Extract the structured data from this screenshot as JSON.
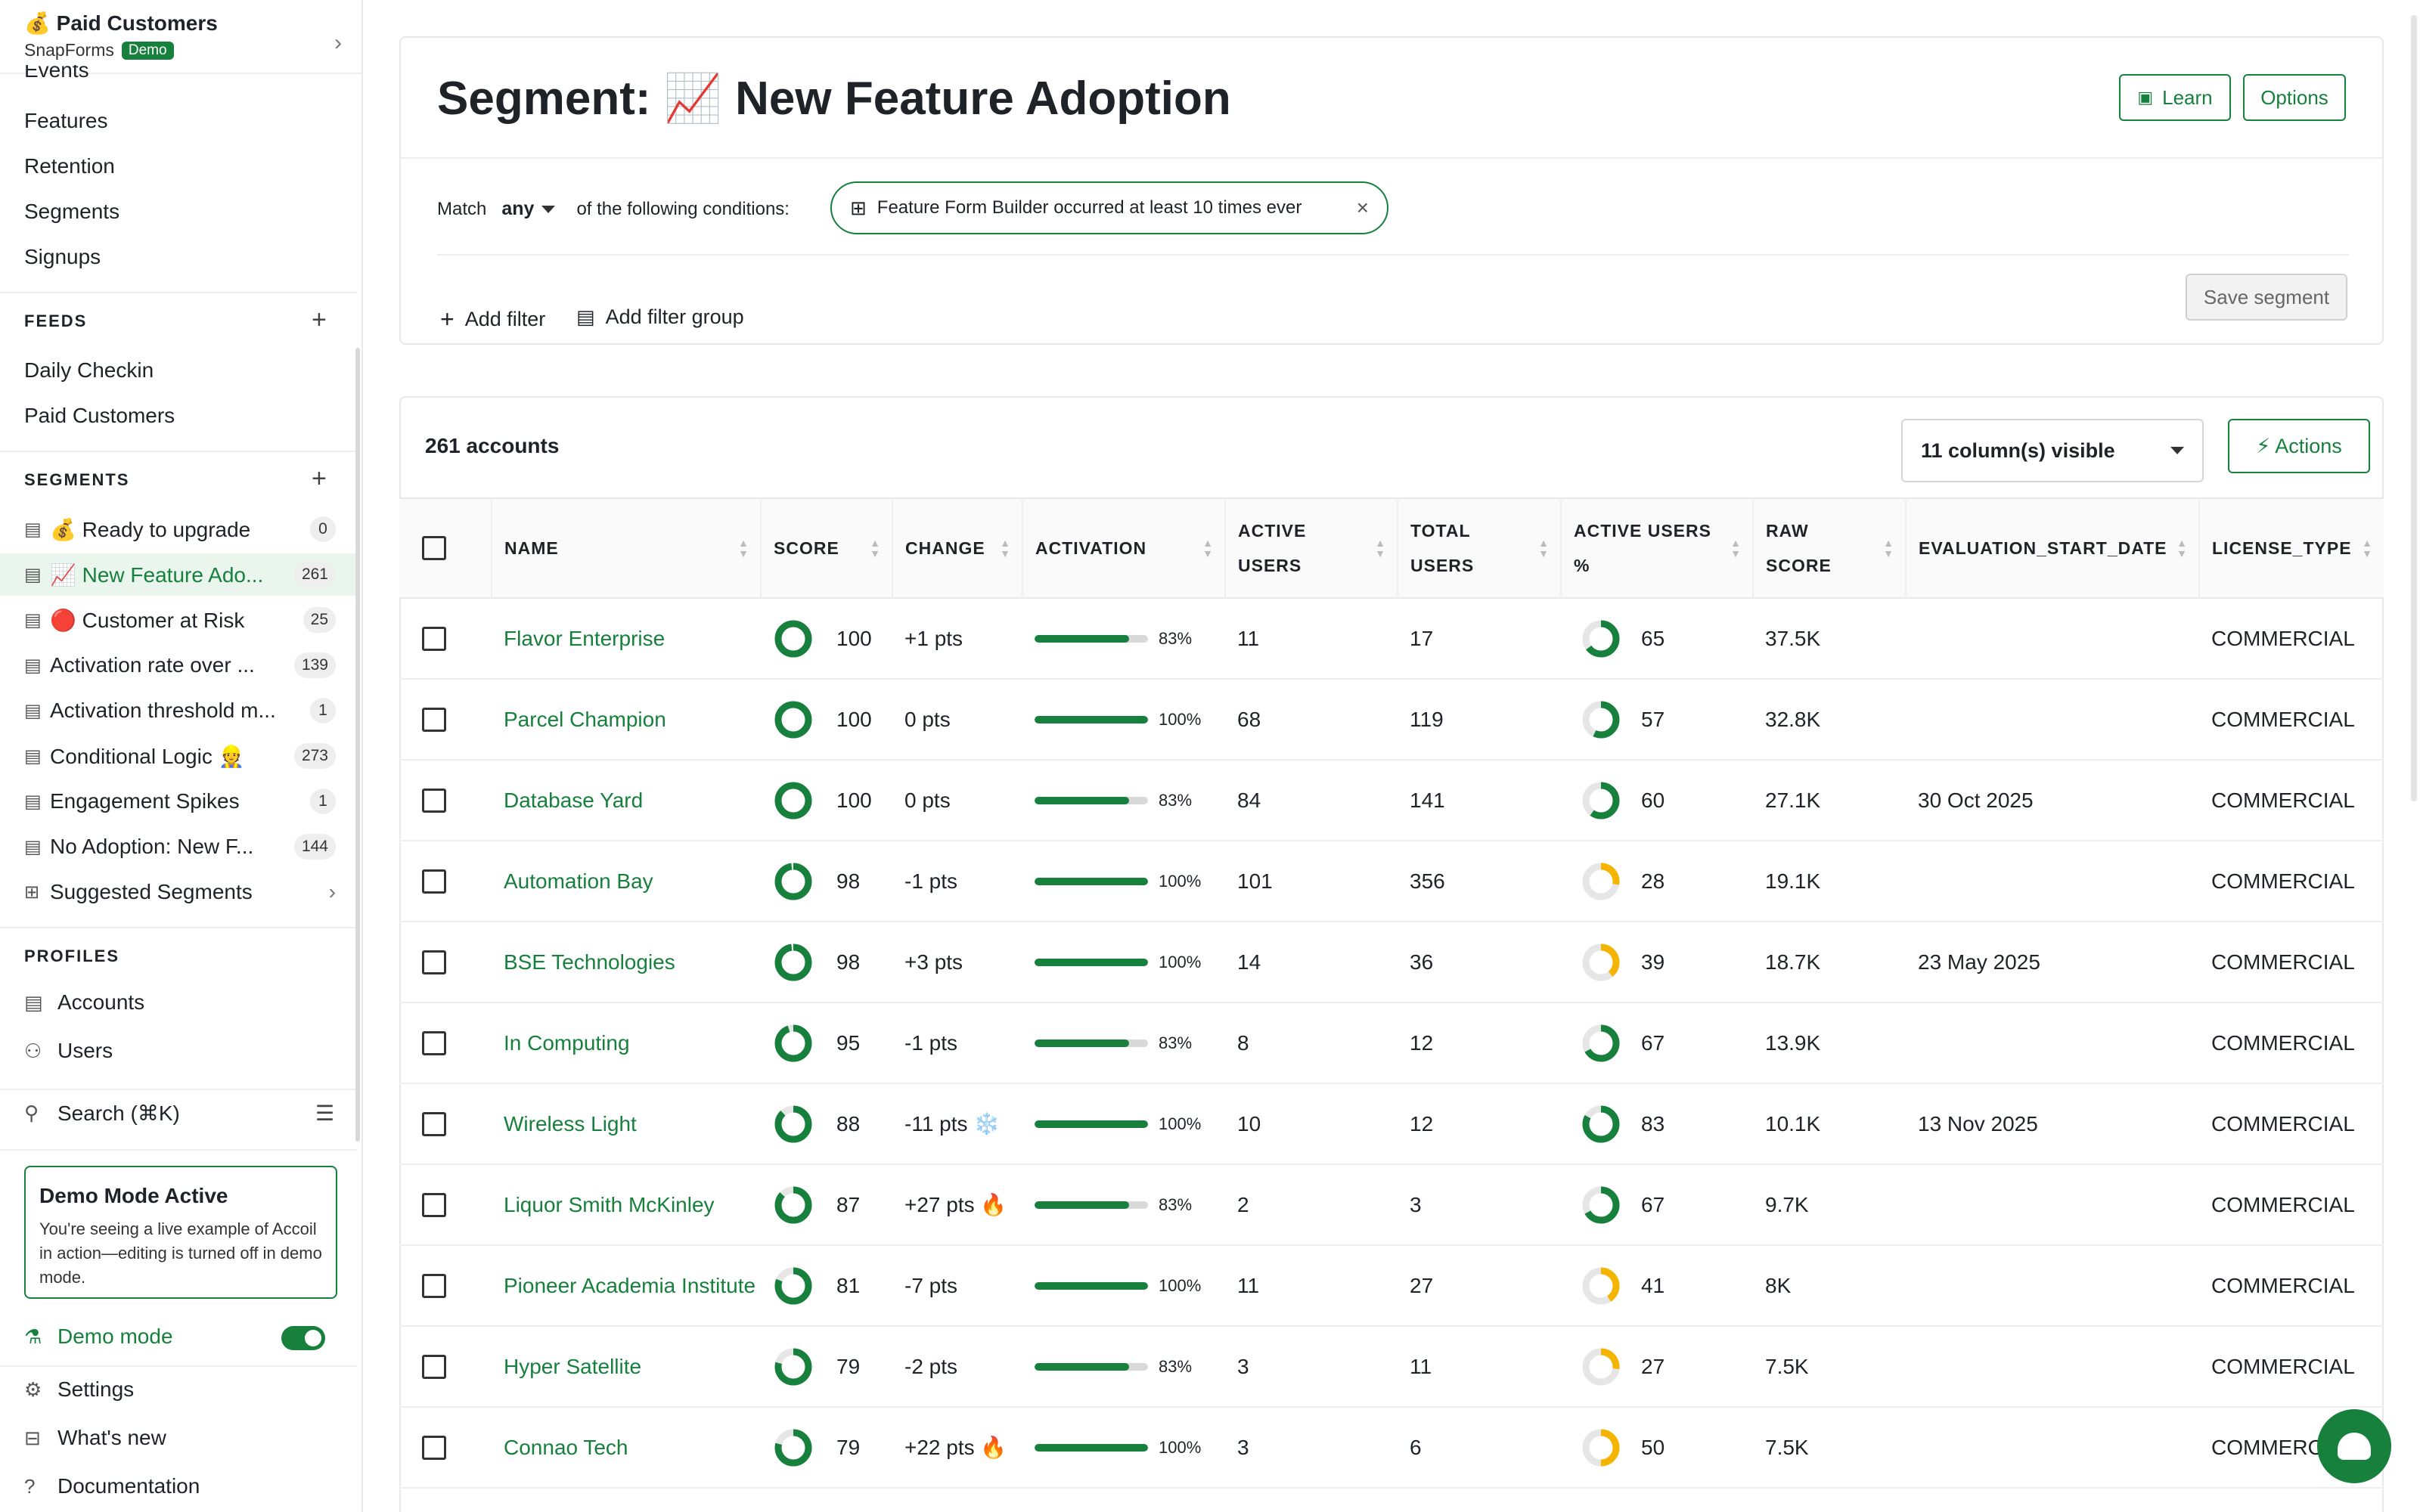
{
  "workspace": {
    "name": "💰 Paid Customers",
    "org": "SnapForms",
    "badge": "Demo"
  },
  "nav": {
    "events": "Events",
    "features": "Features",
    "retention": "Retention",
    "segments": "Segments",
    "signups": "Signups"
  },
  "feeds": {
    "heading": "FEEDS",
    "items": [
      "Daily Checkin",
      "Paid Customers"
    ]
  },
  "segments_section": {
    "heading": "SEGMENTS",
    "items": [
      {
        "label": "💰 Ready to upgrade",
        "count": "0"
      },
      {
        "label": "📈 New Feature Ado...",
        "count": "261"
      },
      {
        "label": "🔴 Customer at Risk",
        "count": "25"
      },
      {
        "label": "Activation rate over ...",
        "count": "139"
      },
      {
        "label": "Activation threshold m...",
        "count": "1"
      },
      {
        "label": "Conditional Logic 👷",
        "count": "273"
      },
      {
        "label": "Engagement Spikes",
        "count": "1"
      },
      {
        "label": "No Adoption: New F...",
        "count": "144"
      }
    ],
    "suggested": "Suggested Segments"
  },
  "profiles": {
    "heading": "PROFILES",
    "accounts": "Accounts",
    "users": "Users"
  },
  "search": "Search (⌘K)",
  "demo_box": {
    "title": "Demo Mode Active",
    "text": "You're seeing a live example of Accoil in action—editing is turned off in demo mode."
  },
  "demo_mode": "Demo mode",
  "footer": {
    "settings": "Settings",
    "whats_new": "What's new",
    "documentation": "Documentation"
  },
  "segment": {
    "title": "Segment: 📈 New Feature Adoption",
    "learn": "Learn",
    "options": "Options",
    "match_label": "Match",
    "match_value": "any",
    "match_suffix": "of the following conditions:",
    "condition": "Feature Form Builder occurred at least 10 times ever",
    "add_filter": "Add filter",
    "add_filter_group": "Add filter group",
    "save": "Save segment"
  },
  "table": {
    "count": "261 accounts",
    "columns_visible": "11 column(s) visible",
    "actions": "⚡ Actions",
    "headers": [
      "NAME",
      "SCORE",
      "CHANGE",
      "ACTIVATION",
      "ACTIVE USERS",
      "TOTAL USERS",
      "ACTIVE USERS %",
      "RAW SCORE",
      "EVALUATION_START_DATE",
      "LICENSE_TYPE"
    ],
    "rows": [
      {
        "name": "Flavor Enterprise",
        "score": "100",
        "change": "+1 pts",
        "activation": "83%",
        "active": "11",
        "total": "17",
        "au_pct": "65",
        "raw": "37.5K",
        "eval": "",
        "license": "COMMERCIAL"
      },
      {
        "name": "Parcel Champion",
        "score": "100",
        "change": "0 pts",
        "activation": "100%",
        "active": "68",
        "total": "119",
        "au_pct": "57",
        "raw": "32.8K",
        "eval": "",
        "license": "COMMERCIAL"
      },
      {
        "name": "Database Yard",
        "score": "100",
        "change": "0 pts",
        "activation": "83%",
        "active": "84",
        "total": "141",
        "au_pct": "60",
        "raw": "27.1K",
        "eval": "30 Oct 2025",
        "license": "COMMERCIAL"
      },
      {
        "name": "Automation Bay",
        "score": "98",
        "change": "-1 pts",
        "activation": "100%",
        "active": "101",
        "total": "356",
        "au_pct": "28",
        "raw": "19.1K",
        "eval": "",
        "license": "COMMERCIAL"
      },
      {
        "name": "BSE Technologies",
        "score": "98",
        "change": "+3 pts",
        "activation": "100%",
        "active": "14",
        "total": "36",
        "au_pct": "39",
        "raw": "18.7K",
        "eval": "23 May 2025",
        "license": "COMMERCIAL"
      },
      {
        "name": "In Computing",
        "score": "95",
        "change": "-1 pts",
        "activation": "83%",
        "active": "8",
        "total": "12",
        "au_pct": "67",
        "raw": "13.9K",
        "eval": "",
        "license": "COMMERCIAL"
      },
      {
        "name": "Wireless Light",
        "score": "88",
        "change": "-11 pts ❄️",
        "activation": "100%",
        "active": "10",
        "total": "12",
        "au_pct": "83",
        "raw": "10.1K",
        "eval": "13 Nov 2025",
        "license": "COMMERCIAL"
      },
      {
        "name": "Liquor Smith McKinley",
        "score": "87",
        "change": "+27 pts 🔥",
        "activation": "83%",
        "active": "2",
        "total": "3",
        "au_pct": "67",
        "raw": "9.7K",
        "eval": "",
        "license": "COMMERCIAL"
      },
      {
        "name": "Pioneer Academia Institute",
        "score": "81",
        "change": "-7 pts",
        "activation": "100%",
        "active": "11",
        "total": "27",
        "au_pct": "41",
        "raw": "8K",
        "eval": "",
        "license": "COMMERCIAL"
      },
      {
        "name": "Hyper Satellite",
        "score": "79",
        "change": "-2 pts",
        "activation": "83%",
        "active": "3",
        "total": "11",
        "au_pct": "27",
        "raw": "7.5K",
        "eval": "",
        "license": "COMMERCIAL"
      },
      {
        "name": "Connao Tech",
        "score": "79",
        "change": "+22 pts 🔥",
        "activation": "100%",
        "active": "3",
        "total": "6",
        "au_pct": "50",
        "raw": "7.5K",
        "eval": "",
        "license": "COMMERCIAL"
      }
    ]
  },
  "colors": {
    "accent": "#17803d",
    "warn": "#f5b400",
    "track": "#e6e6e6"
  }
}
